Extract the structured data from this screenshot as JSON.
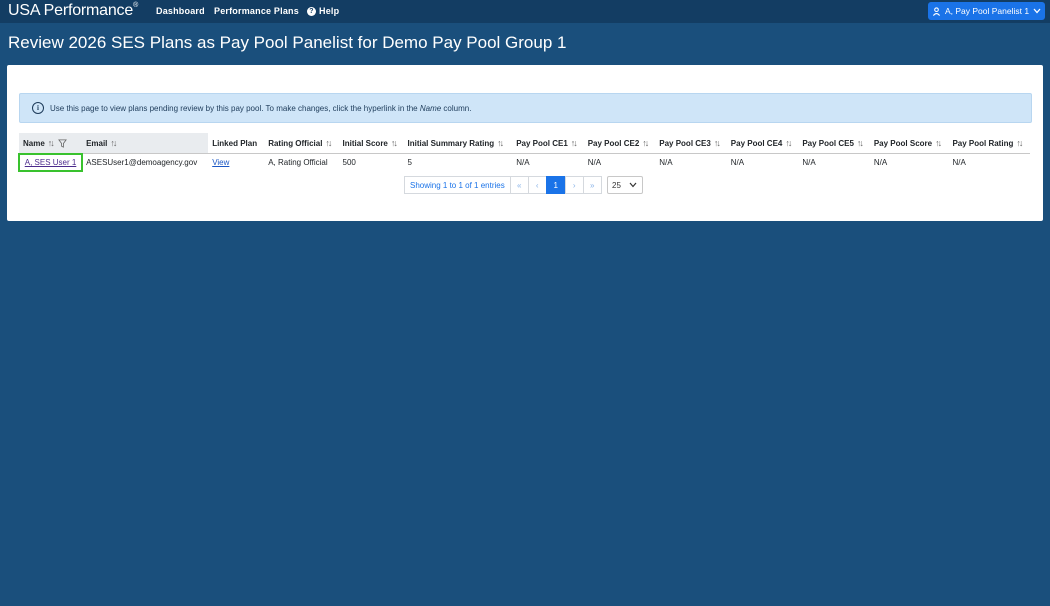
{
  "nav": {
    "brand": "USA Performance",
    "brand_mark": "®",
    "links": [
      "Dashboard",
      "Performance Plans",
      "Help"
    ],
    "user_menu": "A, Pay Pool Panelist 1"
  },
  "page_title": "Review 2026 SES Plans as Pay Pool Panelist for Demo Pay Pool Group 1",
  "info_message": {
    "before": "Use this page to view plans pending review by this pay pool. To make changes, click the hyperlink in the ",
    "emphasis": "Name",
    "after": " column."
  },
  "table": {
    "columns": [
      "Name",
      "Email",
      "Linked Plan",
      "Rating Official",
      "Initial Score",
      "Initial Summary Rating",
      "Pay Pool CE1",
      "Pay Pool CE2",
      "Pay Pool CE3",
      "Pay Pool CE4",
      "Pay Pool CE5",
      "Pay Pool Score",
      "Pay Pool Rating"
    ],
    "rows": [
      [
        "A, SES User 1",
        "ASESUser1@demoagency.gov",
        "View",
        "A, Rating Official",
        "500",
        "5",
        "N/A",
        "N/A",
        "N/A",
        "N/A",
        "N/A",
        "N/A",
        "N/A"
      ]
    ]
  },
  "pagination": {
    "summary": "Showing 1 to 1 of 1 entries",
    "current_page": "1",
    "page_size": "25"
  },
  "colors": {
    "background": "#1a4f7c",
    "navbar": "#133d63",
    "accent": "#1a73e8",
    "highlight": "#39c22e"
  }
}
